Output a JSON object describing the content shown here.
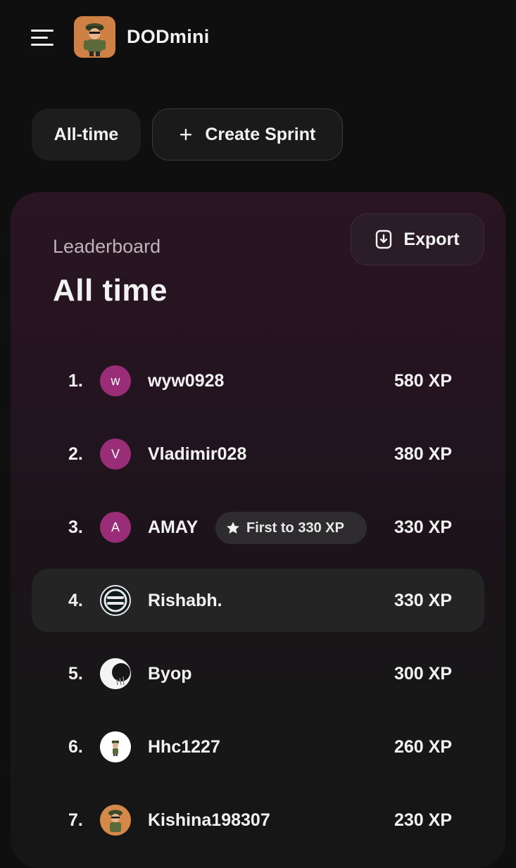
{
  "header": {
    "app_name": "DODmini"
  },
  "filters": {
    "alltime_label": "All-time",
    "create_label": "Create Sprint"
  },
  "leaderboard": {
    "subtitle": "Leaderboard",
    "title": "All time",
    "export_label": "Export",
    "rows": [
      {
        "rank": "1.",
        "avatar": "w",
        "name": "wyw0928",
        "xp": "580 XP"
      },
      {
        "rank": "2.",
        "avatar": "V",
        "name": "Vladimir028",
        "xp": "380 XP"
      },
      {
        "rank": "3.",
        "avatar": "A",
        "name": "AMAY",
        "badge": "First to 330 XP",
        "xp": "330 XP"
      },
      {
        "rank": "4.",
        "avatar": "",
        "name": "Rishabh.",
        "xp": "330 XP"
      },
      {
        "rank": "5.",
        "avatar": "",
        "name": "Byop",
        "xp": "300 XP"
      },
      {
        "rank": "6.",
        "avatar": "",
        "name": "Hhc1227",
        "xp": "260 XP"
      },
      {
        "rank": "7.",
        "avatar": "",
        "name": "Kishina198307",
        "xp": "230 XP"
      }
    ]
  },
  "colors": {
    "background": "#0f0f0f",
    "avatar_accent": "#9a2d78",
    "panel_top": "#2a1522",
    "highlight_row": "#242424"
  },
  "icons": {
    "menu": "menu-icon",
    "plus": "plus-icon",
    "export": "export-file-icon",
    "star": "star-icon"
  }
}
